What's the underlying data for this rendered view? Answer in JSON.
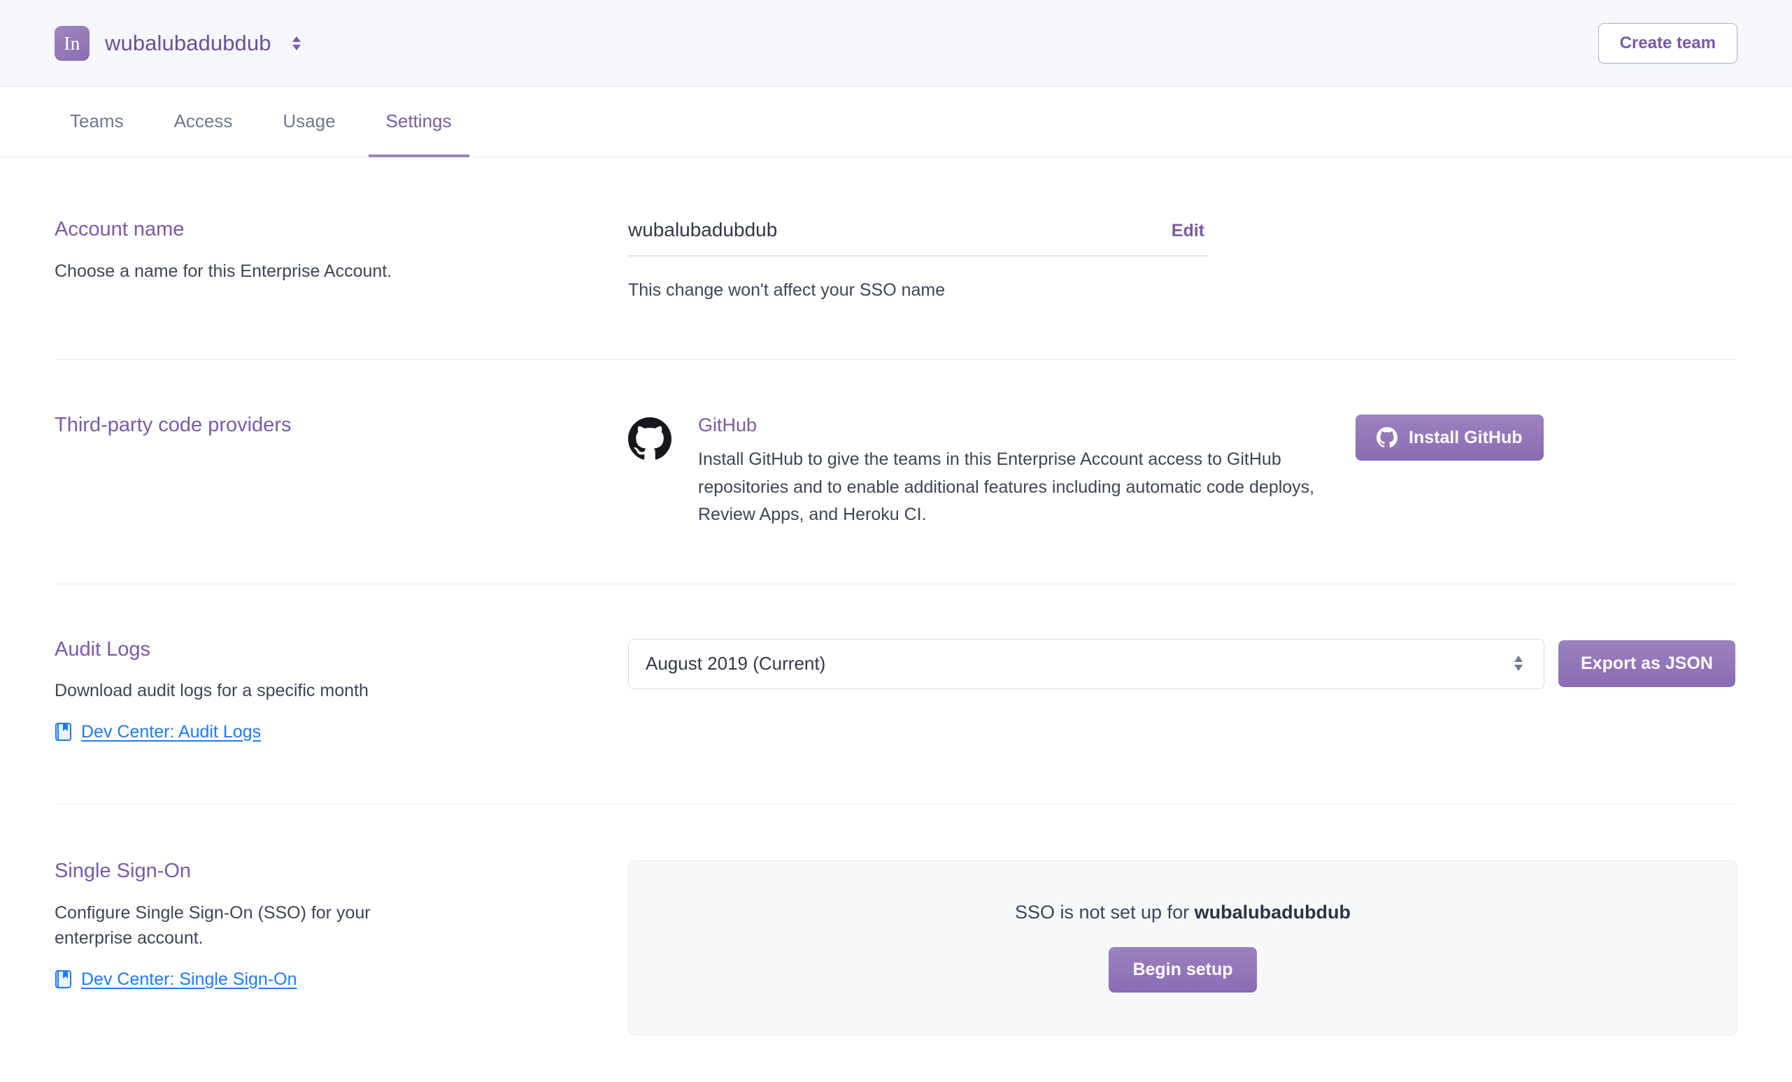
{
  "header": {
    "logo_initials": "In",
    "account_name": "wubalubadubdub",
    "account_switcher_icon": "chevron-up-down-icon",
    "create_team_label": "Create team"
  },
  "tabs": [
    {
      "label": "Teams",
      "active": false
    },
    {
      "label": "Access",
      "active": false
    },
    {
      "label": "Usage",
      "active": false
    },
    {
      "label": "Settings",
      "active": true
    }
  ],
  "account_name_section": {
    "title": "Account name",
    "description": "Choose a name for this Enterprise Account.",
    "field_value": "wubalubadubdub",
    "edit_label": "Edit",
    "hint": "This change won't affect your SSO name"
  },
  "code_providers_section": {
    "title": "Third-party code providers",
    "provider_name": "GitHub",
    "provider_icon": "github-octocat-icon",
    "provider_description": "Install GitHub to give the teams in this Enterprise Account access to GitHub repositories and to enable additional features including automatic code deploys, Review Apps, and Heroku CI.",
    "install_button_label": "Install GitHub"
  },
  "audit_logs_section": {
    "title": "Audit Logs",
    "description": "Download audit logs for a specific month",
    "doc_link_label": "Dev Center: Audit Logs",
    "doc_link_icon": "blue-book-icon",
    "month_selected": "August 2019 (Current)",
    "month_select_icon": "chevron-up-down-icon",
    "export_button_label": "Export as JSON"
  },
  "sso_section": {
    "title": "Single Sign-On",
    "description": "Configure Single Sign-On (SSO) for your enterprise account.",
    "doc_link_label": "Dev Center: Single Sign-On",
    "doc_link_icon": "blue-book-icon",
    "panel_message_prefix": "SSO is not set up for ",
    "panel_message_account": "wubalubadubdub",
    "begin_button_label": "Begin setup"
  },
  "colors": {
    "brand_purple": "#7a5aa8",
    "button_purple": "#8a6cb4",
    "link_blue": "#1d7afc",
    "tab_inactive": "#6e7891",
    "header_bg": "#f5f7fa",
    "divider": "#e8ebf2"
  }
}
